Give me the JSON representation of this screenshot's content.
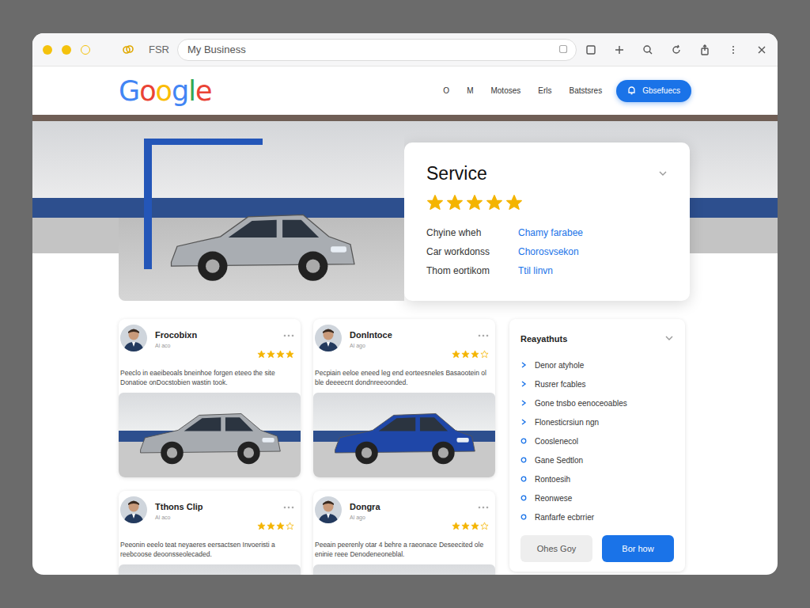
{
  "browser": {
    "prefix": "FSR",
    "address": "My Business"
  },
  "header": {
    "logo": "Google",
    "nav": [
      "O",
      "M",
      "Motoses",
      "Erls",
      "Batstsres"
    ],
    "cta": "Gbsefuecs"
  },
  "service": {
    "title": "Service",
    "stars": 5,
    "rows": [
      {
        "label": "Chyine wheh",
        "value": "Chamy farabee"
      },
      {
        "label": "Car workdonss",
        "value": "Chorosvsekon"
      },
      {
        "label": "Thom eortikom",
        "value": "Ttil linvn"
      }
    ]
  },
  "reviews": [
    {
      "name": "Frocobixn",
      "time": "Al aco",
      "stars": 4,
      "text": "Peeclo in eaeibeoals bneinhoe forgen eteeo the site Donatioe onDocstobien wastin took."
    },
    {
      "name": "Donlntoce",
      "time": "Al ago",
      "stars": 3,
      "text": "Pecpiain eeloe eneed leg end eorteesneles Basaootein ol ble deeeecnt dondnreeoonded."
    },
    {
      "name": "Tthons Clip",
      "time": "Al aco",
      "stars": 3,
      "text": "Peeonin eeelo teat neyaeres eersactsen Invoeristi a reebcoose deoonsseolecaded."
    },
    {
      "name": "Dongra",
      "time": "Al ago",
      "stars": 3,
      "text": "Peeain peerenly otar 4 behre a raeonace Deseecited ole eninie reee Denodeneoneblal."
    }
  ],
  "panel": {
    "title": "Reayathuts",
    "items": [
      {
        "label": "Denor atyhole",
        "kind": "arrow"
      },
      {
        "label": "Rusrer fcables",
        "kind": "arrow"
      },
      {
        "label": "Gone tnsbo eenoceoables",
        "kind": "arrow"
      },
      {
        "label": "Flonesticrsiun ngn",
        "kind": "arrow"
      },
      {
        "label": "Cooslenecol",
        "kind": "circle"
      },
      {
        "label": "Gane Sedtlon",
        "kind": "circle"
      },
      {
        "label": "Rontoesih",
        "kind": "circle"
      },
      {
        "label": "Reonwese",
        "kind": "circle"
      },
      {
        "label": "Ranfarfe ecbrrier",
        "kind": "circle"
      }
    ],
    "buttons": [
      {
        "label": "Ohes Goy",
        "kind": "secondary"
      },
      {
        "label": "Bor how",
        "kind": "primary"
      }
    ]
  }
}
